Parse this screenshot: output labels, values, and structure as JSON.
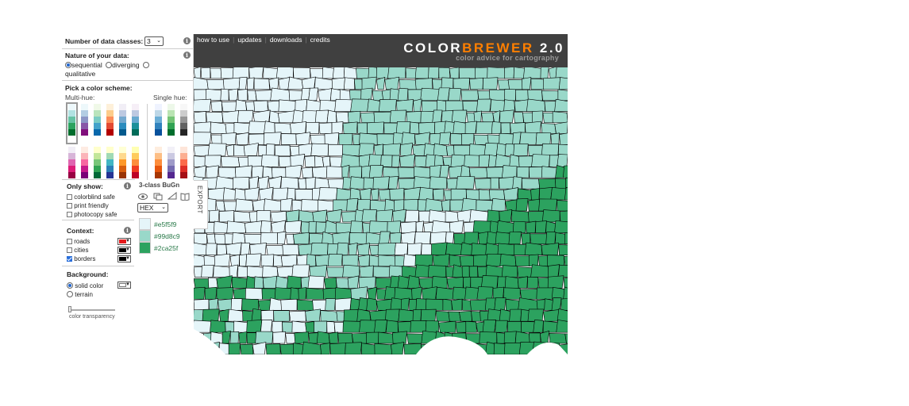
{
  "sidebar": {
    "num_classes": {
      "label": "Number of data classes:",
      "value": "3"
    },
    "nature": {
      "label": "Nature of your data:",
      "options": [
        "sequential",
        "diverging",
        "qualitative"
      ],
      "selected": "sequential"
    },
    "scheme": {
      "label": "Pick a color scheme:",
      "multi_hue_label": "Multi-hue:",
      "single_hue_label": "Single hue:",
      "multi_hue_row1": [
        [
          "#edf8fb",
          "#b2e2e2",
          "#66c2a4",
          "#2ca25f",
          "#006d2c"
        ],
        [
          "#edf8fb",
          "#b3cde3",
          "#8c96c6",
          "#8856a7",
          "#810f7c"
        ],
        [
          "#f0f9e8",
          "#bae4bc",
          "#7bccc4",
          "#43a2ca",
          "#0868ac"
        ],
        [
          "#fef0d9",
          "#fdcc8a",
          "#fc8d59",
          "#e34a33",
          "#b30000"
        ],
        [
          "#f1eef6",
          "#bdc9e1",
          "#74a9cf",
          "#2b8cbe",
          "#045a8d"
        ],
        [
          "#f6eff7",
          "#bdc9e1",
          "#67a9cf",
          "#1c9099",
          "#016c59"
        ]
      ],
      "multi_hue_row2": [
        [
          "#f1eef6",
          "#d7b5d8",
          "#df65b0",
          "#dd1c77",
          "#980043"
        ],
        [
          "#feebe2",
          "#fbb4b9",
          "#f768a1",
          "#c51b8a",
          "#7a0177"
        ],
        [
          "#ffffcc",
          "#c2e699",
          "#78c679",
          "#31a354",
          "#006837"
        ],
        [
          "#ffffcc",
          "#a1dab4",
          "#41b6c4",
          "#2c7fb8",
          "#253494"
        ],
        [
          "#ffffd4",
          "#fed98e",
          "#fe9929",
          "#d95f0e",
          "#993404"
        ],
        [
          "#ffffb2",
          "#fecc5c",
          "#fd8d3c",
          "#f03b20",
          "#bd0026"
        ]
      ],
      "single_hue_row1": [
        [
          "#eff3ff",
          "#bdd7e7",
          "#6baed6",
          "#3182bd",
          "#08519c"
        ],
        [
          "#edf8e9",
          "#bae4b3",
          "#74c476",
          "#31a354",
          "#006d2c"
        ],
        [
          "#f7f7f7",
          "#cccccc",
          "#969696",
          "#636363",
          "#252525"
        ]
      ],
      "single_hue_row2": [
        [
          "#feedde",
          "#fdbe85",
          "#fd8d3c",
          "#e6550d",
          "#a63603"
        ],
        [
          "#f2f0f7",
          "#cbc9e2",
          "#9e9ac8",
          "#756bb1",
          "#54278f"
        ],
        [
          "#fee5d9",
          "#fcae91",
          "#fb6a4a",
          "#de2d26",
          "#a50f15"
        ]
      ]
    },
    "only_show": {
      "label": "Only show:",
      "options": [
        {
          "label": "colorblind safe",
          "checked": false
        },
        {
          "label": "print friendly",
          "checked": false
        },
        {
          "label": "photocopy safe",
          "checked": false
        }
      ]
    },
    "context": {
      "label": "Context:",
      "options": [
        {
          "label": "roads",
          "checked": false,
          "color": "#e41a1c"
        },
        {
          "label": "cities",
          "checked": false,
          "color": "#000000"
        },
        {
          "label": "borders",
          "checked": true,
          "color": "#000000"
        }
      ]
    },
    "background": {
      "label": "Background:",
      "options": [
        "solid color",
        "terrain"
      ],
      "selected": "solid color",
      "solid_color": "#ffffff"
    },
    "transparency_label": "color transparency",
    "transparency_value": 0
  },
  "export": {
    "title": "3-class BuGn",
    "format": "HEX",
    "tab_label": "EXPORT",
    "colors": [
      {
        "hex": "#e5f5f9"
      },
      {
        "hex": "#99d8c9"
      },
      {
        "hex": "#2ca25f"
      }
    ]
  },
  "header": {
    "nav": [
      "how to use",
      "updates",
      "downloads",
      "credits"
    ],
    "logo_a": "COLOR",
    "logo_b": "BREWER",
    "logo_c": " 2.0",
    "tagline": "color advice for cartography",
    "accent": "#ff7f00",
    "bg": "#404040"
  },
  "map": {
    "colors": [
      "#e5f5f9",
      "#99d8c9",
      "#2ca25f"
    ]
  }
}
